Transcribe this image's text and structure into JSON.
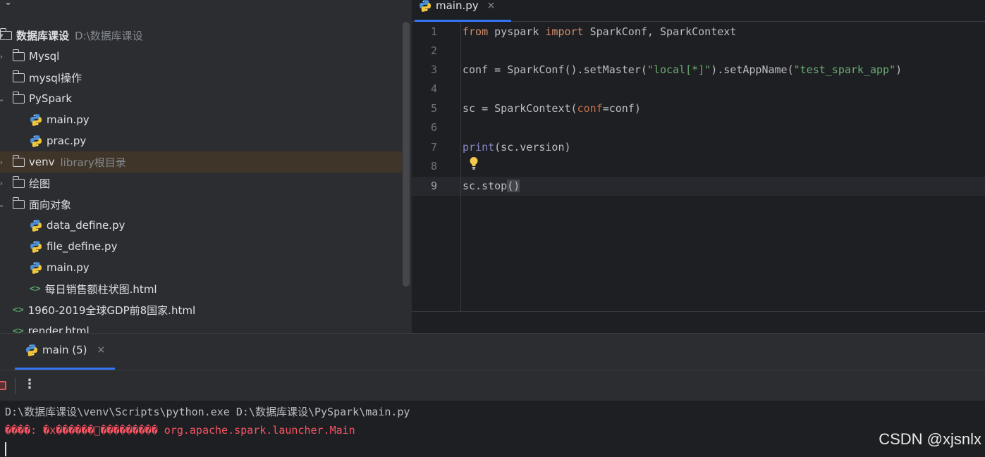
{
  "project": {
    "rows": [
      {
        "arrow": "▾",
        "type": "folder",
        "label": "数据库课设",
        "hint": "D:\\数据库课设",
        "bold": true
      },
      {
        "arrow": "›",
        "type": "folder",
        "label": "Mysql"
      },
      {
        "arrow": "",
        "type": "folder",
        "label": "mysql操作"
      },
      {
        "arrow": "⌄",
        "type": "folder",
        "label": "PySpark"
      },
      {
        "arrow": "",
        "type": "py",
        "label": "main.py"
      },
      {
        "arrow": "",
        "type": "py",
        "label": "prac.py"
      },
      {
        "arrow": "›",
        "type": "folder",
        "label": "venv",
        "hint": "library根目录",
        "selected": true
      },
      {
        "arrow": "›",
        "type": "folder",
        "label": "绘图"
      },
      {
        "arrow": "⌄",
        "type": "folder",
        "label": "面向对象"
      },
      {
        "arrow": "",
        "type": "py",
        "label": "data_define.py"
      },
      {
        "arrow": "",
        "type": "py",
        "label": "file_define.py"
      },
      {
        "arrow": "",
        "type": "py",
        "label": "main.py"
      },
      {
        "arrow": "",
        "type": "html",
        "label": "每日销售额柱状图.html"
      },
      {
        "arrow": "",
        "type": "html",
        "label": "1960-2019全球GDP前8国家.html"
      },
      {
        "arrow": "",
        "type": "html",
        "label": "render.html"
      }
    ]
  },
  "editor": {
    "tab_label": "main.py",
    "tab_close": "×",
    "lines": [
      {
        "n": "1",
        "tokens": [
          {
            "t": "from",
            "c": "kw"
          },
          {
            "t": " pyspark "
          },
          {
            "t": "import",
            "c": "kw"
          },
          {
            "t": " SparkConf, SparkContext"
          }
        ]
      },
      {
        "n": "2",
        "tokens": []
      },
      {
        "n": "3",
        "tokens": [
          {
            "t": "conf = SparkConf().setMaster("
          },
          {
            "t": "\"local[*]\"",
            "c": "str"
          },
          {
            "t": ").setAppName("
          },
          {
            "t": "\"test_spark_app\"",
            "c": "str"
          },
          {
            "t": ")"
          }
        ]
      },
      {
        "n": "4",
        "tokens": []
      },
      {
        "n": "5",
        "tokens": [
          {
            "t": "sc = SparkContext("
          },
          {
            "t": "conf",
            "c": "param"
          },
          {
            "t": "=conf)"
          }
        ]
      },
      {
        "n": "6",
        "tokens": []
      },
      {
        "n": "7",
        "tokens": [
          {
            "t": "print",
            "c": "builtin"
          },
          {
            "t": "(sc.version)"
          }
        ]
      },
      {
        "n": "8",
        "tokens": []
      },
      {
        "n": "9",
        "tokens": [
          {
            "t": "sc.stop"
          },
          {
            "t": "()",
            "c": "bracket-hl"
          }
        ],
        "current": true
      }
    ]
  },
  "run": {
    "tab_label": "main (5)",
    "tab_close": "×",
    "more_glyph": "⋮",
    "command_line": "D:\\数据库课设\\venv\\Scripts\\python.exe D:\\数据库课设\\PySpark\\main.py",
    "error_line": "����: �x������\u0000��������� org.apache.spark.launcher.Main"
  },
  "watermark": "CSDN @xjsnlx",
  "colors": {
    "accent": "#3574f0",
    "error": "#f75464",
    "keyword": "#cf8e6d",
    "string": "#6aab73"
  }
}
